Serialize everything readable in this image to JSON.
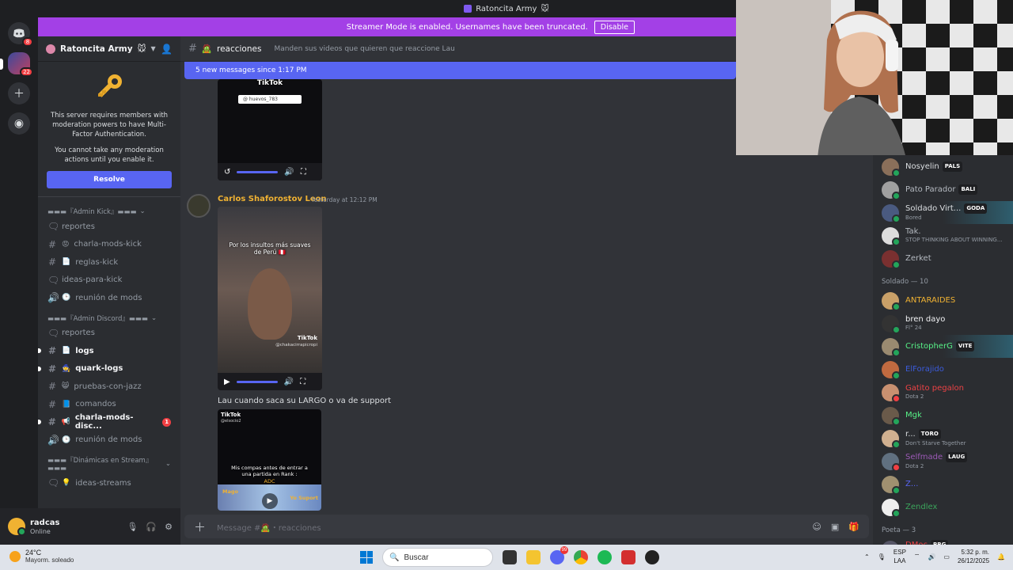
{
  "window": {
    "title": "Ratoncita Army",
    "title_emoji": "🐭"
  },
  "rail": {
    "dm_badge": "8",
    "server_badge": "22"
  },
  "banner": {
    "text": "Streamer Mode is enabled. Usernames have been truncated.",
    "button": "Disable"
  },
  "server": {
    "name": "Ratoncita Army",
    "name_emoji": "🐭"
  },
  "mfa": {
    "line1": "This server requires members with moderation powers to have Multi-Factor Authentication.",
    "line2": "You cannot take any moderation actions until you enable it.",
    "button": "Resolve"
  },
  "categories": [
    {
      "label": "▬▬▬『Admin Kick』▬▬▬",
      "channels": [
        {
          "type": "forum",
          "emoji": "",
          "name": "reportes",
          "bold": false,
          "mention": ""
        },
        {
          "type": "text",
          "emoji": "😡",
          "name": "charla-mods-kick",
          "bold": false,
          "mention": ""
        },
        {
          "type": "text",
          "emoji": "📄",
          "name": "reglas-kick",
          "bold": false,
          "mention": ""
        },
        {
          "type": "forum",
          "emoji": "",
          "name": "ideas-para-kick",
          "bold": false,
          "mention": ""
        },
        {
          "type": "voice",
          "emoji": "🕒",
          "name": "reunión de mods",
          "bold": false,
          "mention": ""
        }
      ]
    },
    {
      "label": "▬▬▬『Admin Discord』▬▬▬",
      "channels": [
        {
          "type": "forum",
          "emoji": "",
          "name": "reportes",
          "bold": false,
          "mention": ""
        },
        {
          "type": "text",
          "emoji": "📄",
          "name": "logs",
          "bold": true,
          "mention": ""
        },
        {
          "type": "text",
          "emoji": "🧙",
          "name": "quark-logs",
          "bold": true,
          "mention": ""
        },
        {
          "type": "text",
          "emoji": "😸",
          "name": "pruebas-con-jazz",
          "bold": false,
          "mention": ""
        },
        {
          "type": "text",
          "emoji": "📘",
          "name": "comandos",
          "bold": false,
          "mention": ""
        },
        {
          "type": "text",
          "emoji": "📢",
          "name": "charla-mods-disc...",
          "bold": true,
          "mention": "1"
        },
        {
          "type": "voice",
          "emoji": "🕒",
          "name": "reunión de mods",
          "bold": false,
          "mention": ""
        }
      ]
    },
    {
      "label": "▬▬▬『Dinámicas en Stream』▬▬▬",
      "channels": [
        {
          "type": "forum",
          "emoji": "💡",
          "name": "ideas-streams",
          "bold": false,
          "mention": ""
        }
      ]
    }
  ],
  "user": {
    "name": "radcas",
    "status": "Online"
  },
  "channel": {
    "name": "reacciones",
    "emoji": "🧟",
    "topic": "Manden sus videos que quieren que reaccione Lau"
  },
  "newbar": {
    "text": "5 new messages since 1:17 PM"
  },
  "messages": {
    "top_video_label": "TikTok",
    "top_video_handle": "@ huevos_783",
    "author": "Carlos Shaforostov Leon",
    "time": "Yesterday at 12:12 PM",
    "video1_caption": "Por los insultos más suaves de Perú 🇵🇪",
    "video1_tiktok": "TikTok",
    "video1_handle": "@chakacirrapicropi",
    "text": "Lau cuando saca su LARGO o va de support",
    "video2_tiktok": "TikTok",
    "video2_handle": "@elsocio2",
    "video2_caption": "Mis compas antes de entrar a una partida en Rank :",
    "video2_adc": "ADC",
    "video2_mago": "Mago",
    "video2_support": "Yo Suport"
  },
  "composer": {
    "placeholder": "Message #🧟・reacciones"
  },
  "members": {
    "top": [
      {
        "name": "Nosyelin",
        "tag": "PALS",
        "sub": "",
        "color": "#dbdee1",
        "hl": false,
        "dnd": false
      },
      {
        "name": "Pato Parador",
        "tag": "BALI",
        "sub": "",
        "color": "#b5bac1",
        "hl": false,
        "dnd": false
      },
      {
        "name": "Soldado Virt...",
        "tag": "GODA",
        "sub": "Bored",
        "color": "#dbdee1",
        "hl": true,
        "dnd": false
      },
      {
        "name": "Tak.",
        "tag": "",
        "sub": "STOP THINKING ABOUT WINNING...",
        "color": "#b5bac1",
        "hl": false,
        "dnd": false
      },
      {
        "name": "Zerket",
        "tag": "",
        "sub": "",
        "color": "#b5bac1",
        "hl": false,
        "dnd": false
      }
    ],
    "group_soldado": "Soldado — 10",
    "soldado": [
      {
        "name": "ANTARAIDES",
        "tag": "",
        "sub": "",
        "color": "#f0b232",
        "hl": false,
        "dnd": false
      },
      {
        "name": "bren dayo",
        "tag": "",
        "sub": "Fl° 24",
        "color": "#f2f3f5",
        "hl": false,
        "dnd": false
      },
      {
        "name": "CristopherG",
        "tag": "VITE",
        "sub": "",
        "color": "#57f287",
        "hl": true,
        "dnd": false
      },
      {
        "name": "ElForajido",
        "tag": "",
        "sub": "",
        "color": "#3b5bdb",
        "hl": false,
        "dnd": false
      },
      {
        "name": "Gatito pegalon",
        "tag": "",
        "sub": "Dota 2",
        "color": "#ed4245",
        "hl": false,
        "dnd": true
      },
      {
        "name": "Mgk",
        "tag": "",
        "sub": "",
        "color": "#57f287",
        "hl": false,
        "dnd": false
      },
      {
        "name": "r...",
        "tag": "TORO",
        "sub": "Don't Starve Together",
        "color": "#dbdee1",
        "hl": false,
        "dnd": false
      },
      {
        "name": "Selfmade",
        "tag": "LAUG",
        "sub": "Dota 2",
        "color": "#9b59b6",
        "hl": false,
        "dnd": true
      },
      {
        "name": "Z...",
        "tag": "",
        "sub": "",
        "color": "#5865f2",
        "hl": false,
        "dnd": false
      },
      {
        "name": "Zendlex",
        "tag": "",
        "sub": "",
        "color": "#3ba55c",
        "hl": false,
        "dnd": false
      }
    ],
    "group_poeta": "Poeta — 3",
    "poeta": [
      {
        "name": "DMoc",
        "tag": "BBG",
        "sub": "Minecraft",
        "color": "#ed4245",
        "hl": false,
        "dnd": false
      }
    ]
  },
  "taskbar": {
    "temp": "24°C",
    "weather": "Mayorm. soleado",
    "search": "Buscar",
    "discord_badge": "99",
    "lang1": "ESP",
    "lang2": "LAA",
    "time": "5:32 p. m.",
    "date": "26/12/2025"
  }
}
